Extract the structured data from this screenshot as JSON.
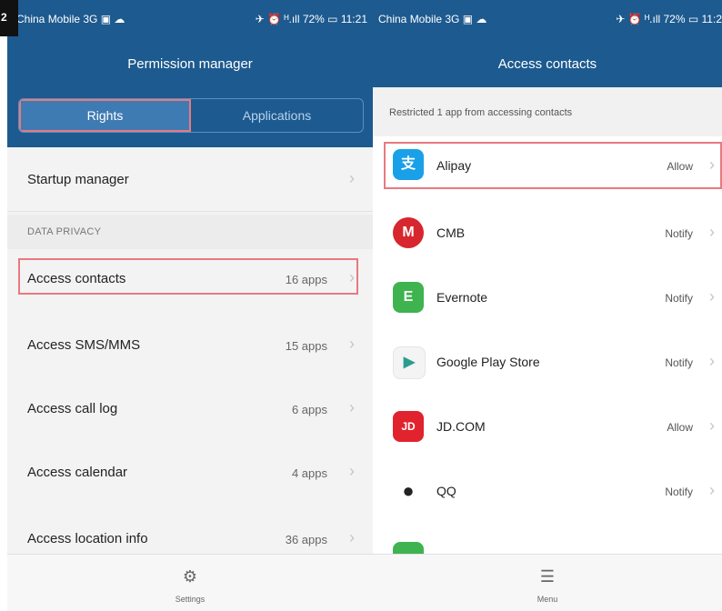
{
  "corner_digit": "2",
  "left": {
    "status": {
      "carrier": "China Mobile 3G ▣ ☁",
      "right": "✈ ⏰ ᴴ.ıll 72% ▭ 11:21"
    },
    "title": "Permission manager",
    "tabs": [
      {
        "label": "Rights",
        "active": true
      },
      {
        "label": "Applications",
        "active": false
      }
    ],
    "startup": {
      "label": "Startup manager"
    },
    "section_header": "DATA PRIVACY",
    "items": [
      {
        "label": "Access contacts",
        "count": "16 apps"
      },
      {
        "label": "Access SMS/MMS",
        "count": "15 apps"
      },
      {
        "label": "Access call log",
        "count": "6 apps"
      },
      {
        "label": "Access calendar",
        "count": "4 apps"
      },
      {
        "label": "Access location info",
        "count": "36 apps"
      }
    ],
    "bottom": {
      "icon": "gear-icon",
      "label": "Settings"
    }
  },
  "right": {
    "status": {
      "carrier": "China Mobile 3G ▣ ☁",
      "right": "✈ ⏰ ᴴ.ıll 72% ▭ 11:2"
    },
    "title": "Access contacts",
    "info": "Restricted 1 app from accessing contacts",
    "apps": [
      {
        "name": "Alipay",
        "permission": "Allow",
        "icon": "alipay-icon",
        "glyph": "支",
        "color": "#1aa0e8"
      },
      {
        "name": "CMB",
        "permission": "Notify",
        "icon": "cmb-icon",
        "glyph": "M",
        "color": "#d7262e"
      },
      {
        "name": "Evernote",
        "permission": "Notify",
        "icon": "evernote-icon",
        "glyph": "E",
        "color": "#3fb34f"
      },
      {
        "name": "Google Play Store",
        "permission": "Notify",
        "icon": "google-play-icon",
        "glyph": "▶",
        "color": "#f4f4f4"
      },
      {
        "name": "JD.COM",
        "permission": "Allow",
        "icon": "jd-icon",
        "glyph": "JD",
        "color": "#e1232d"
      },
      {
        "name": "QQ",
        "permission": "Notify",
        "icon": "qq-icon",
        "glyph": "●",
        "color": "#222222"
      }
    ],
    "bottom": {
      "icon": "menu-icon",
      "label": "Menu"
    }
  }
}
